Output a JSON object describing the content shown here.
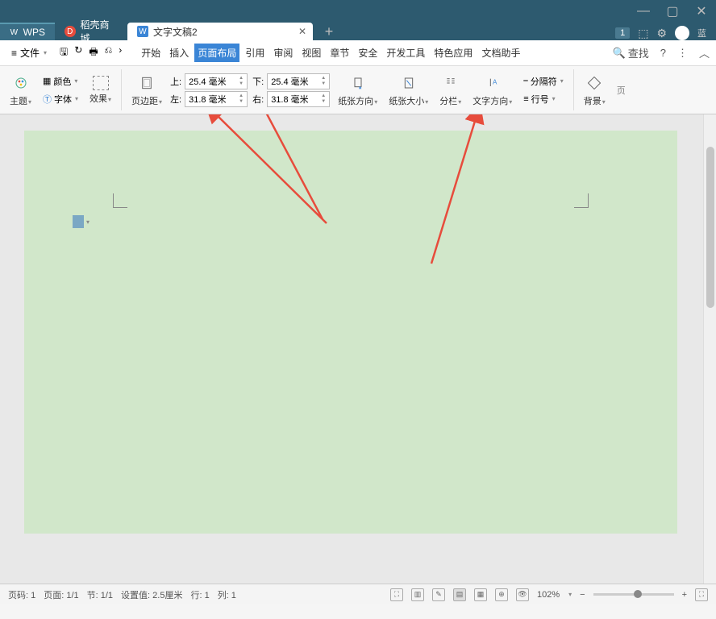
{
  "titlebar": {
    "user": "蓝"
  },
  "tabs": {
    "wps": "WPS",
    "docer": "稻壳商城",
    "document": "文字文稿2",
    "badge": "1"
  },
  "menu": {
    "file": "文件",
    "items": [
      "开始",
      "插入",
      "页面布局",
      "引用",
      "审阅",
      "视图",
      "章节",
      "安全",
      "开发工具",
      "特色应用",
      "文档助手"
    ],
    "active_index": 2,
    "search": "查找"
  },
  "ribbon": {
    "theme": "主题",
    "color": "颜色",
    "font": "字体",
    "effect": "效果",
    "margin": "页边距",
    "margins": {
      "top_label": "上:",
      "top_value": "25.4 毫米",
      "bottom_label": "下:",
      "bottom_value": "25.4 毫米",
      "left_label": "左:",
      "left_value": "31.8 毫米",
      "right_label": "右:",
      "right_value": "31.8 毫米"
    },
    "orientation": "纸张方向",
    "size": "纸张大小",
    "columns": "分栏",
    "text_direction": "文字方向",
    "separator": "分隔符",
    "line_numbers": "行号",
    "background": "背景",
    "page": "页"
  },
  "statusbar": {
    "page_num": "页码: 1",
    "page": "页面: 1/1",
    "section": "节: 1/1",
    "position": "设置值: 2.5厘米",
    "row": "行: 1",
    "col": "列: 1",
    "zoom": "102%"
  }
}
